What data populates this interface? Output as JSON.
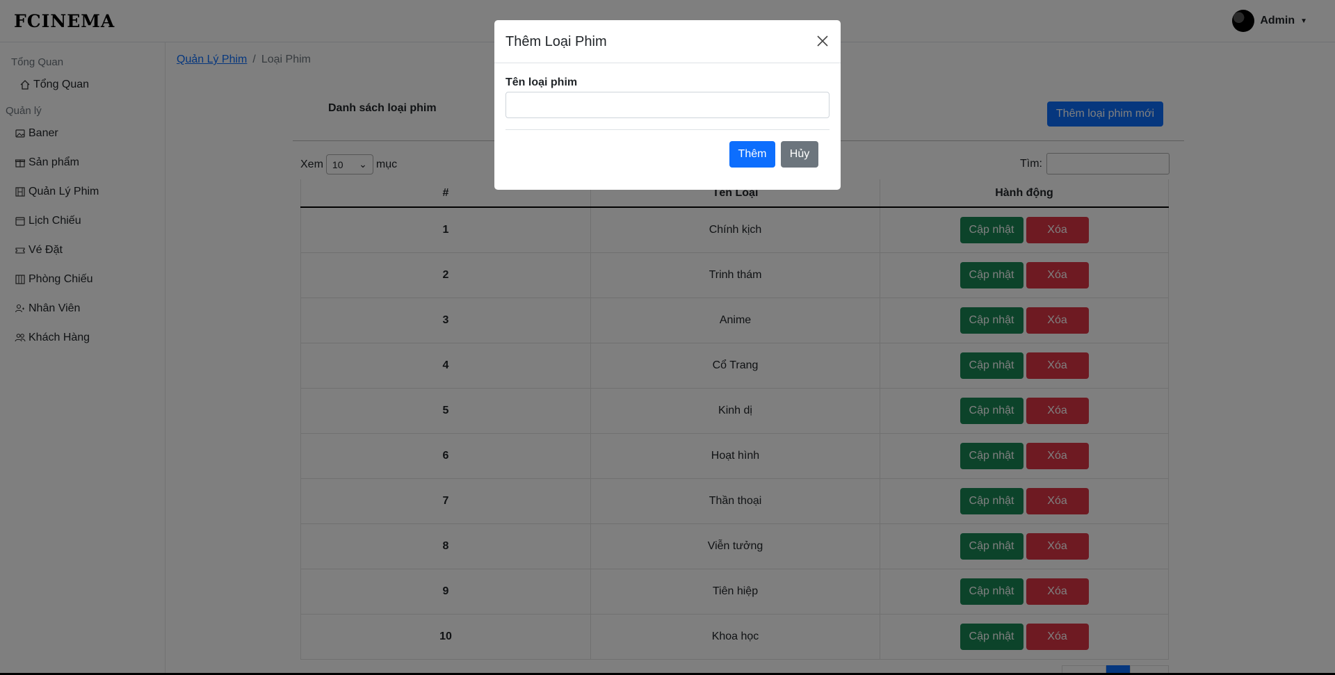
{
  "header": {
    "logo": "FCINEMA",
    "user_name": "Admin"
  },
  "sidebar": {
    "section_overview": "Tổng Quan",
    "overview_item": "Tổng Quan",
    "section_manage": "Quản lý",
    "items": [
      {
        "label": "Baner",
        "icon": "image-icon"
      },
      {
        "label": "Sản phẩm",
        "icon": "gift-icon"
      },
      {
        "label": "Quản Lý Phim",
        "icon": "film-icon"
      },
      {
        "label": "Lịch Chiếu",
        "icon": "calendar-icon"
      },
      {
        "label": "Vé Đặt",
        "icon": "ticket-icon"
      },
      {
        "label": "Phòng Chiếu",
        "icon": "columns-icon"
      },
      {
        "label": "Nhân Viên",
        "icon": "person-icon"
      },
      {
        "label": "Khách Hàng",
        "icon": "people-icon"
      }
    ]
  },
  "breadcrumb": {
    "parent": "Quản Lý Phim",
    "current": "Loại Phim",
    "separator": "/"
  },
  "main": {
    "list_title": "Danh sách loại phim",
    "add_new_label": "Thêm loại phim mới",
    "show_prefix": "Xem",
    "page_size": "10",
    "show_suffix": "mục",
    "search_label": "Tìm:"
  },
  "table": {
    "headers": [
      "#",
      "Tên Loại",
      "Hành động"
    ],
    "update_label": "Cập nhật",
    "delete_label": "Xóa",
    "rows": [
      {
        "idx": "1",
        "name": "Chính kịch"
      },
      {
        "idx": "2",
        "name": "Trinh thám"
      },
      {
        "idx": "3",
        "name": "Anime"
      },
      {
        "idx": "4",
        "name": "Cổ Trang"
      },
      {
        "idx": "5",
        "name": "Kinh dị"
      },
      {
        "idx": "6",
        "name": "Hoạt hình"
      },
      {
        "idx": "7",
        "name": "Thần thoại"
      },
      {
        "idx": "8",
        "name": "Viễn tưởng"
      },
      {
        "idx": "9",
        "name": "Tiên hiệp"
      },
      {
        "idx": "10",
        "name": "Khoa học"
      }
    ]
  },
  "modal": {
    "title": "Thêm Loại Phim",
    "field_label": "Tên loại phim",
    "field_value": "",
    "submit_label": "Thêm",
    "cancel_label": "Hủy"
  },
  "colors": {
    "primary": "#0d6efd",
    "success": "#198754",
    "danger": "#dc3545",
    "secondary": "#6c757d"
  }
}
